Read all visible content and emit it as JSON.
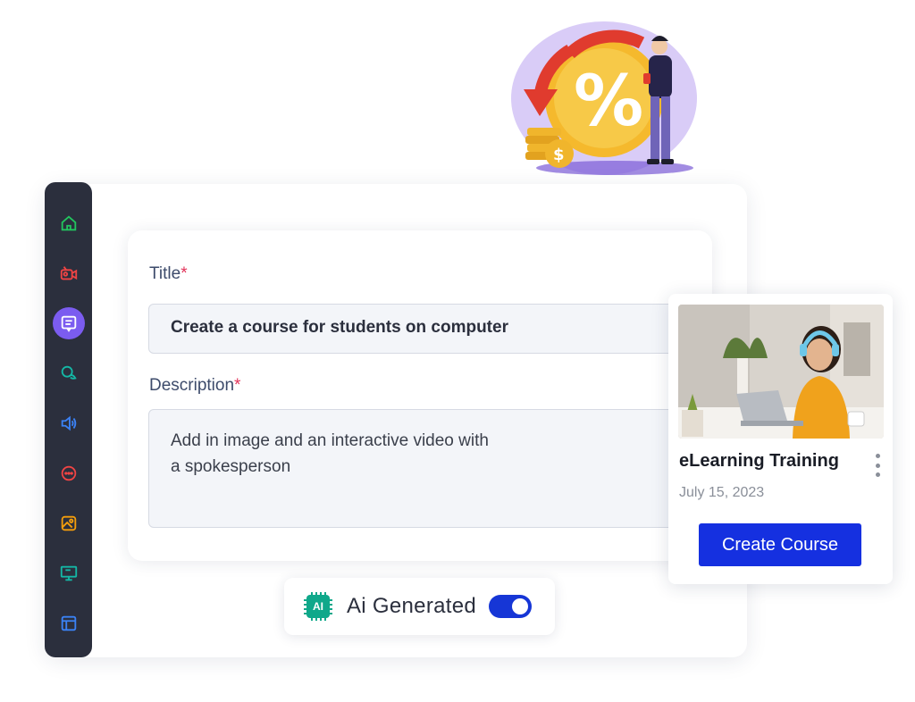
{
  "sidebar": {
    "items": [
      {
        "icon": "home-icon",
        "color": "#22c55e"
      },
      {
        "icon": "video-camera-icon",
        "color": "#ef4444"
      },
      {
        "icon": "document-icon",
        "color": "#ffffff",
        "active": true
      },
      {
        "icon": "chat-bubbles-icon",
        "color": "#14b8a6"
      },
      {
        "icon": "speaker-icon",
        "color": "#3b82f6"
      },
      {
        "icon": "message-dots-icon",
        "color": "#ef4444"
      },
      {
        "icon": "image-icon",
        "color": "#f59e0b"
      },
      {
        "icon": "presentation-icon",
        "color": "#14b8a6"
      },
      {
        "icon": "layout-icon",
        "color": "#3b82f6"
      }
    ],
    "active_color": "#7b5cf0"
  },
  "form": {
    "title_label": "Title",
    "title_value": "Create a course for students on computer",
    "description_label": "Description",
    "description_lines": [
      "Add in image and an interactive video with",
      "a spokesperson"
    ],
    "required_mark": "*"
  },
  "ai_toggle": {
    "chip_text": "AI",
    "label": "Ai Generated",
    "enabled": true
  },
  "course_card": {
    "title": "eLearning Training",
    "date": "July 15, 2023",
    "button_label": "Create Course"
  },
  "illustration": {
    "symbol": "%",
    "coin_symbol": "$"
  },
  "colors": {
    "primary_button": "#1530e0",
    "sidebar_bg": "#2b2f3d",
    "required": "#e2345a"
  }
}
